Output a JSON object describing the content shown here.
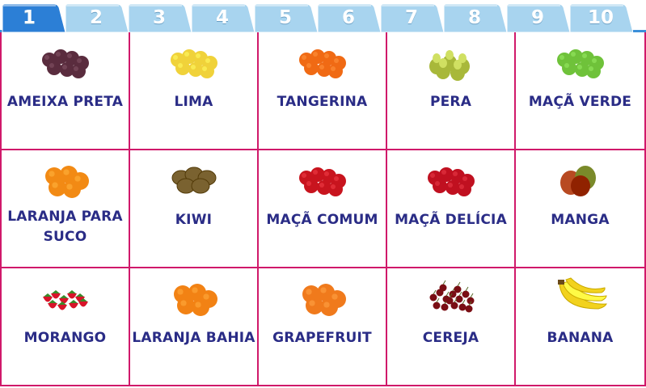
{
  "tabs": [
    {
      "label": "1",
      "selected": true
    },
    {
      "label": "2",
      "selected": false
    },
    {
      "label": "3",
      "selected": false
    },
    {
      "label": "4",
      "selected": false
    },
    {
      "label": "5",
      "selected": false
    },
    {
      "label": "6",
      "selected": false
    },
    {
      "label": "7",
      "selected": false
    },
    {
      "label": "8",
      "selected": false
    },
    {
      "label": "9",
      "selected": false
    },
    {
      "label": "10",
      "selected": false
    }
  ],
  "fruits": [
    {
      "name": "AMEIXA PRETA",
      "icon": "black-plum-icon",
      "color": "#5a2c3e"
    },
    {
      "name": "LIMA",
      "icon": "lime-icon",
      "color": "#f0d23a"
    },
    {
      "name": "TANGERINA",
      "icon": "tangerine-icon",
      "color": "#f06a14"
    },
    {
      "name": "PERA",
      "icon": "pear-icon",
      "color": "#a8b83a"
    },
    {
      "name": "MAÇÃ VERDE",
      "icon": "green-apple-icon",
      "color": "#6fc23a"
    },
    {
      "name": "LARANJA PARA SUCO",
      "icon": "juice-orange-icon",
      "color": "#f28a14"
    },
    {
      "name": "KIWI",
      "icon": "kiwi-icon",
      "color": "#7a6230"
    },
    {
      "name": "MAÇÃ COMUM",
      "icon": "common-apple-icon",
      "color": "#c8141e"
    },
    {
      "name": "MAÇÃ DELÍCIA",
      "icon": "delicious-apple-icon",
      "color": "#c01020"
    },
    {
      "name": "MANGA",
      "icon": "mango-icon",
      "color": "#b84a22"
    },
    {
      "name": "MORANGO",
      "icon": "strawberry-icon",
      "color": "#d8142a"
    },
    {
      "name": "LARANJA BAHIA",
      "icon": "navel-orange-icon",
      "color": "#f28214"
    },
    {
      "name": "GRAPEFRUIT",
      "icon": "grapefruit-icon",
      "color": "#f07a1c"
    },
    {
      "name": "CEREJA",
      "icon": "cherry-icon",
      "color": "#7a0e14"
    },
    {
      "name": "BANANA",
      "icon": "banana-icon",
      "color": "#f2d21e"
    }
  ],
  "colors": {
    "tab_selected": "#2c7fd6",
    "tab_unselected": "#a8d4ef",
    "grid_line": "#d0196a",
    "label_text": "#2a2c86"
  }
}
